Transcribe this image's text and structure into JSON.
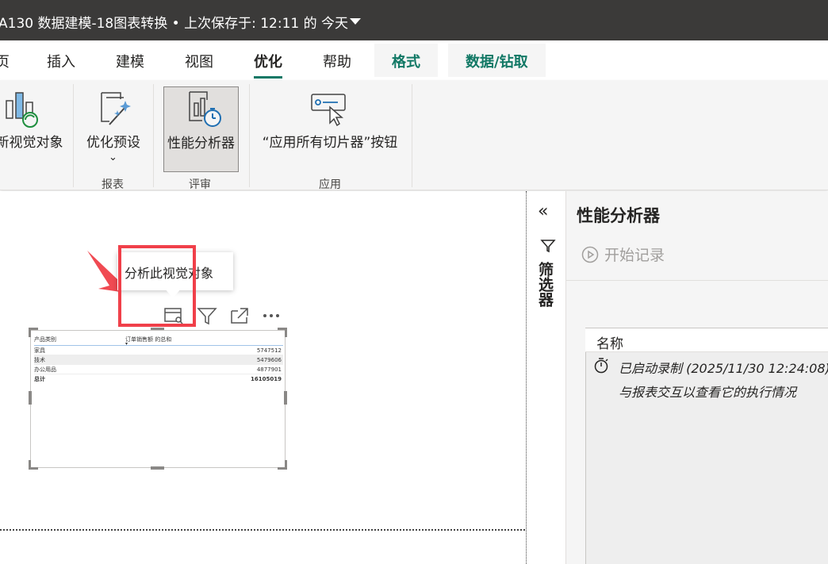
{
  "window": {
    "title": "A130 数据建模-18图表转换 • 上次保存于: 12:11 的 今天"
  },
  "tabs": [
    {
      "label": "页"
    },
    {
      "label": "插入"
    },
    {
      "label": "建模"
    },
    {
      "label": "视图"
    },
    {
      "label": "优化"
    },
    {
      "label": "帮助"
    },
    {
      "label": "格式"
    },
    {
      "label": "数据/钻取"
    }
  ],
  "ribbon": {
    "refresh_visuals_label": "新视觉对象",
    "optimize_presets_label": "优化预设",
    "performance_analyzer_label": "性能分析器",
    "apply_slicers_label": "“应用所有切片器”按钮",
    "groups": {
      "report": "报表",
      "review": "评审",
      "apply": "应用"
    }
  },
  "tooltip": {
    "text": "分析此视觉对象"
  },
  "visual_table": {
    "col1": "产品类别",
    "col2": "订单销售额 的总和",
    "rows": [
      {
        "category": "家具",
        "value": "5747512"
      },
      {
        "category": "技术",
        "value": "5479606"
      },
      {
        "category": "办公用品",
        "value": "4877901"
      }
    ],
    "total": {
      "category": "总计",
      "value": "16105019"
    }
  },
  "filters": {
    "label": "筛选器"
  },
  "performance_analyzer": {
    "title": "性能分析器",
    "start_recording": "开始记录",
    "column_name": "名称",
    "message_line1": "已启动录制 (2025/11/30 12:24:08)",
    "message_line2": "与报表交互以查看它的执行情况"
  }
}
